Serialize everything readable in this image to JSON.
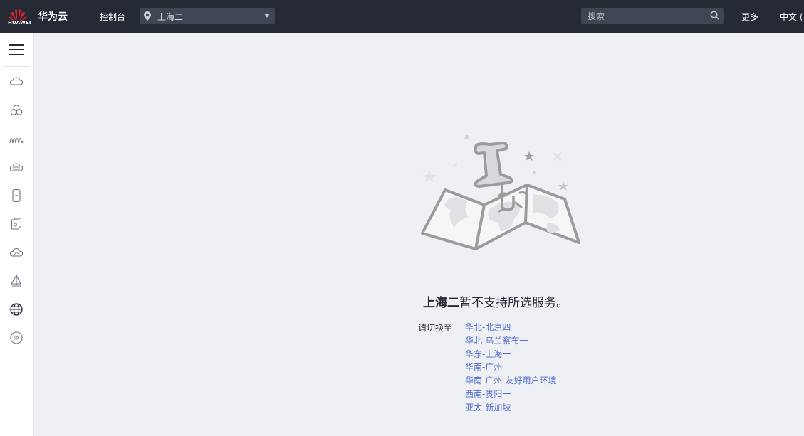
{
  "header": {
    "logo_text": "HUAWEI",
    "brand": "华为云",
    "console": "控制台",
    "region": "上海二",
    "search_placeholder": "搜索",
    "more": "更多",
    "language": "中文 ("
  },
  "sidebar": {
    "items": [
      "menu-icon",
      "cloud-icon",
      "clover-icon",
      "waves-icon",
      "cloud-storage-icon",
      "mobile-icon",
      "documents-icon",
      "cloud-sync-icon",
      "sail-icon",
      "globe-icon",
      "ip-icon"
    ]
  },
  "main": {
    "message_region": "上海二",
    "message_suffix": "暂不支持所选服务。",
    "switch_label": "请切换至",
    "regions": [
      "华北-北京四",
      "华北-乌兰察布一",
      "华东-上海一",
      "华南-广州",
      "华南-广州-友好用户环境",
      "西南-贵阳一",
      "亚太-新加坡"
    ]
  },
  "colors": {
    "topbar": "#252a35",
    "link": "#526ecc",
    "background": "#eff0f4",
    "brand_red": "#e6212a"
  }
}
